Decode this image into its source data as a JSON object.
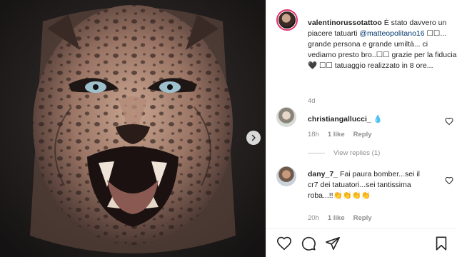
{
  "post": {
    "image_alt": "",
    "owner": "valentinorussotattoo",
    "caption_pre": " È stato davvero un piacere tatuarti ",
    "mention": "@matteopolitano16",
    "caption_post": " ☐☐... grande persona e grande umiltà... ci vediamo presto bro..☐☐ grazie per la fiducia🖤 ☐☐ tatuaggio realizzato in 8 ore...",
    "time": "4d"
  },
  "comments": [
    {
      "username": "christiangallucci_",
      "text": " 💧",
      "time": "18h",
      "likes": "1 like",
      "reply": "Reply"
    },
    {
      "username": "dany_7_",
      "text": " Fai paura bomber...sei il cr7 dei tatuatori...sei tantissima roba...!!👏👏👏👏",
      "time": "20h",
      "likes": "1 like",
      "reply": "Reply"
    }
  ],
  "view_replies": "View replies (1)",
  "icons": {
    "next": "chevron-right-icon",
    "like": "heart-icon",
    "comment": "comment-icon",
    "share": "paper-plane-icon",
    "save": "bookmark-icon"
  },
  "colors": {
    "mention": "#00376b",
    "meta": "#8e8e8e",
    "text": "#262626"
  }
}
